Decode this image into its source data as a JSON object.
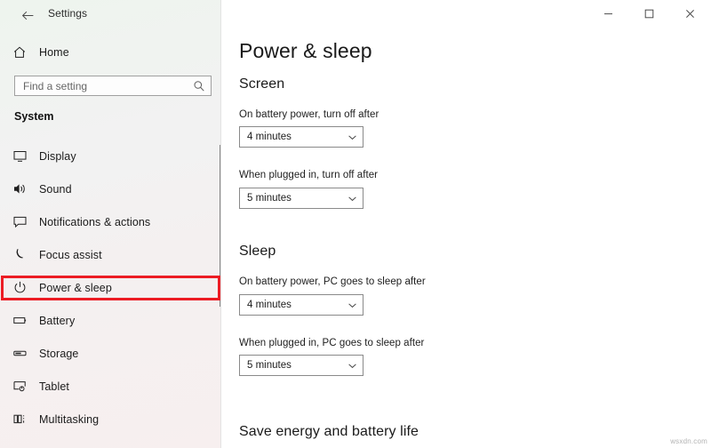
{
  "window": {
    "title": "Settings",
    "back_icon": "back-arrow-icon",
    "controls": {
      "minimize": "minimize-icon",
      "maximize": "maximize-icon",
      "close": "close-icon"
    }
  },
  "sidebar": {
    "home": {
      "label": "Home",
      "icon": "home-icon"
    },
    "search": {
      "placeholder": "Find a setting",
      "value": "",
      "icon": "search-icon"
    },
    "group_label": "System",
    "items": [
      {
        "label": "Display",
        "icon": "monitor-icon",
        "selected": false
      },
      {
        "label": "Sound",
        "icon": "speaker-icon",
        "selected": false
      },
      {
        "label": "Notifications & actions",
        "icon": "chat-bubble-icon",
        "selected": false
      },
      {
        "label": "Focus assist",
        "icon": "moon-icon",
        "selected": false
      },
      {
        "label": "Power & sleep",
        "icon": "power-icon",
        "selected": true
      },
      {
        "label": "Battery",
        "icon": "battery-icon",
        "selected": false
      },
      {
        "label": "Storage",
        "icon": "storage-icon",
        "selected": false
      },
      {
        "label": "Tablet",
        "icon": "tablet-icon",
        "selected": false
      },
      {
        "label": "Multitasking",
        "icon": "multitasking-icon",
        "selected": false
      }
    ],
    "highlight_color": "#ec1c24",
    "highlighted_item": "Power & sleep"
  },
  "main": {
    "page_title": "Power & sleep",
    "sections": [
      {
        "heading": "Screen"
      },
      {
        "heading": "Sleep"
      },
      {
        "heading": "Save energy and battery life"
      }
    ],
    "fields": [
      {
        "label": "On battery power, turn off after",
        "value": "4 minutes"
      },
      {
        "label": "When plugged in, turn off after",
        "value": "5 minutes"
      },
      {
        "label": "On battery power, PC goes to sleep after",
        "value": "4 minutes"
      },
      {
        "label": "When plugged in, PC goes to sleep after",
        "value": "5 minutes"
      }
    ]
  },
  "watermark": "wsxdn.com"
}
